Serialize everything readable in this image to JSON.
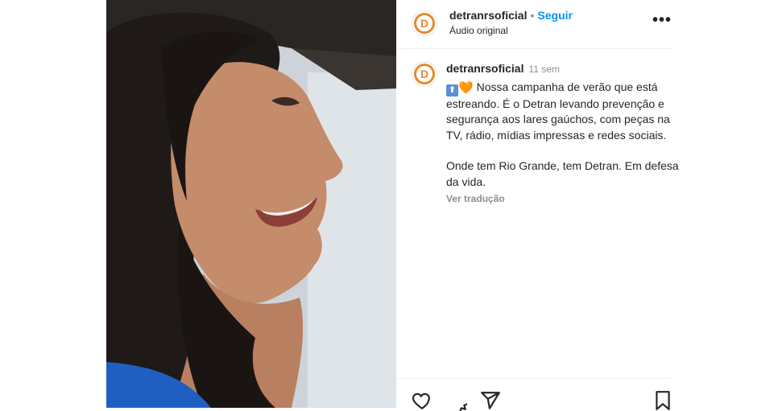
{
  "post": {
    "account": "detranrsoficial",
    "separator": "•",
    "follow_label": "Seguir",
    "audio": "Áudio original",
    "more_label": "•••"
  },
  "caption": {
    "username": "detranrsoficial",
    "time": "11 sem",
    "emoji_up": "⬆",
    "emoji_heart": "🧡",
    "line1": "Nossa campanha de verão que está estreando. É o Detran levando prevenção e segurança aos lares gaúchos, com peças na TV, rádio, mídias impressas e redes sociais.",
    "line2": "Onde tem Rio Grande, tem Detran. Em defesa da vida.",
    "translate": "Ver tradução"
  },
  "avatar_letter": "D",
  "icons": {
    "like": "heart-icon",
    "comment": "comment-icon",
    "share": "send-icon",
    "save": "bookmark-icon"
  },
  "colors": {
    "follow": "#0095f6",
    "brand": "#e58a2f"
  }
}
